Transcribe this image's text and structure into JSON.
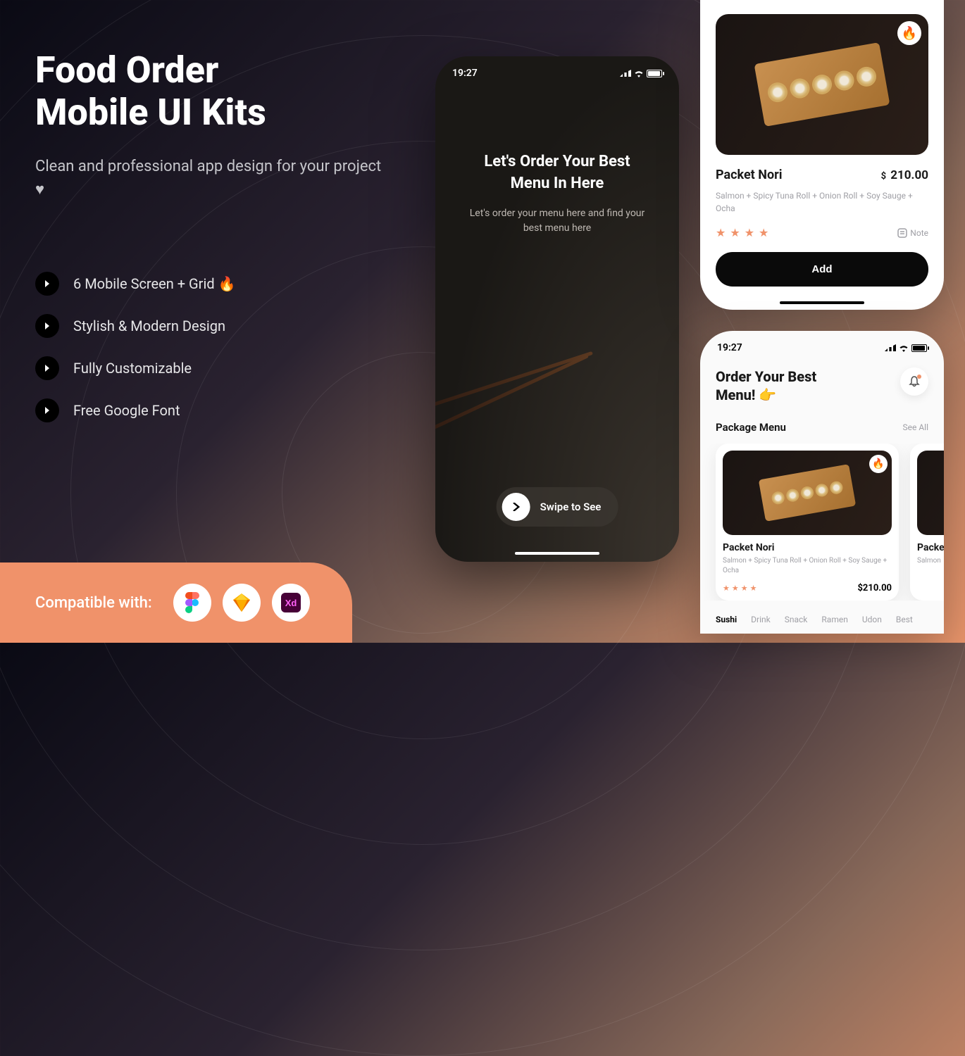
{
  "hero": {
    "title_line1": "Food Order",
    "title_line2": "Mobile UI Kits",
    "subtitle": "Clean and professional app design for your project ♥",
    "features": [
      "6 Mobile Screen + Grid 🔥",
      "Stylish & Modern Design",
      "Fully Customizable",
      "Free Google Font"
    ]
  },
  "compat": {
    "label": "Compatible with:",
    "tools": [
      "figma",
      "sketch",
      "xd"
    ]
  },
  "phone1": {
    "time": "19:27",
    "title": "Let's Order Your Best Menu In Here",
    "subtitle": "Let's order your menu here and find your best menu here",
    "swipe": "Swipe to See"
  },
  "phone2": {
    "fire": "🔥",
    "name": "Packet Nori",
    "price": "210.00",
    "currency": "$",
    "desc": "Salmon + Spicy Tuna Roll + Onion Roll + Soy Sauge + Ocha",
    "note": "Note",
    "add": "Add",
    "star": "★"
  },
  "phone3": {
    "time": "19:27",
    "title_l1": "Order Your Best",
    "title_l2": "Menu! 👉",
    "section": "Package Menu",
    "seeall": "See All",
    "cards": [
      {
        "name": "Packet Nori",
        "desc": "Salmon + Spicy Tuna Roll + Onion Roll + Soy Sauge + Ocha",
        "price": "$210.00"
      },
      {
        "name": "Packe",
        "desc": "Salmon",
        "price": ""
      }
    ],
    "tabs": [
      "Sushi",
      "Drink",
      "Snack",
      "Ramen",
      "Udon",
      "Best"
    ]
  }
}
